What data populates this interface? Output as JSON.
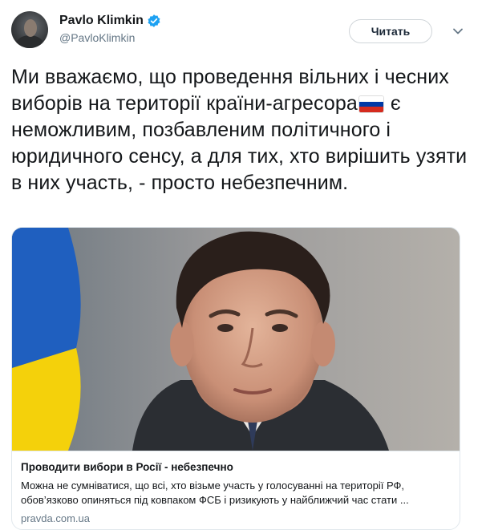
{
  "header": {
    "display_name": "Pavlo Klimkin",
    "handle": "@PavloKlimkin",
    "follow_label": "Читать"
  },
  "tweet": {
    "text_before_flag": "Ми вважаємо, що проведення вільних і чесних виборів на території країни-агресора",
    "flag_icon": "russia-flag-icon",
    "text_after_flag": " є неможливим, позбавленим політичного і юридичного сенсу, а для тих, хто вирішить узяти в них участь, - просто небезпечним."
  },
  "card": {
    "title": "Проводити вибори в Росії - небезпечно",
    "description": "Можна не сумніватися, що всі, хто візьме участь у голосуванні на території РФ, обов’язково опиняться під ковпаком ФСБ і ризикують у найближчий час стати ...",
    "domain": "pravda.com.ua"
  },
  "colors": {
    "verified": "#1da1f2",
    "secondary_text": "#657786",
    "flag_white": "#ffffff",
    "flag_blue": "#0039a6",
    "flag_red": "#d52b1e",
    "ukraine_blue": "#1f5fbf",
    "ukraine_yellow": "#f4d10b"
  }
}
